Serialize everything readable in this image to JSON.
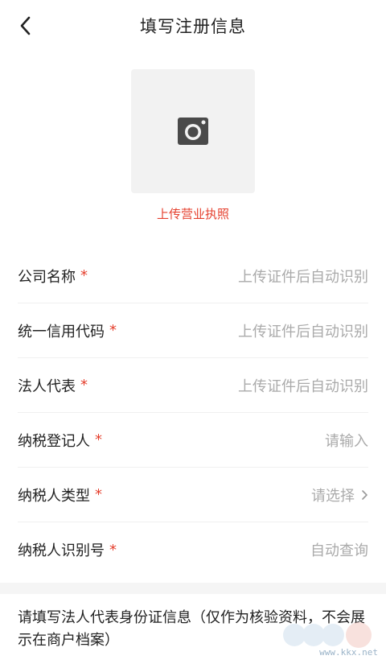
{
  "header": {
    "title": "填写注册信息",
    "back_icon": "chevron-left-icon"
  },
  "upload": {
    "label": "上传营业执照",
    "icon": "camera-icon"
  },
  "form": {
    "rows": [
      {
        "label": "公司名称",
        "required_mark": "*",
        "value": "上传证件后自动识别"
      },
      {
        "label": "统一信用代码",
        "required_mark": "*",
        "value": "上传证件后自动识别"
      },
      {
        "label": "法人代表",
        "required_mark": "*",
        "value": "上传证件后自动识别"
      },
      {
        "label": "纳税登记人",
        "required_mark": "*",
        "value": "请输入"
      },
      {
        "label": "纳税人类型",
        "required_mark": "*",
        "value": "请选择"
      },
      {
        "label": "纳税人识别号",
        "required_mark": "*",
        "value": "自动查询"
      }
    ]
  },
  "info": {
    "text": "请填写法人代表身份证信息（仅作为核验资料，不会展示在商户档案）"
  },
  "watermark": {
    "logo_text": "KK下载",
    "url": "www.kkx.net"
  },
  "colors": {
    "accent": "#e5402e",
    "placeholder": "#aaaaaa",
    "divider": "#f0f0f0"
  }
}
